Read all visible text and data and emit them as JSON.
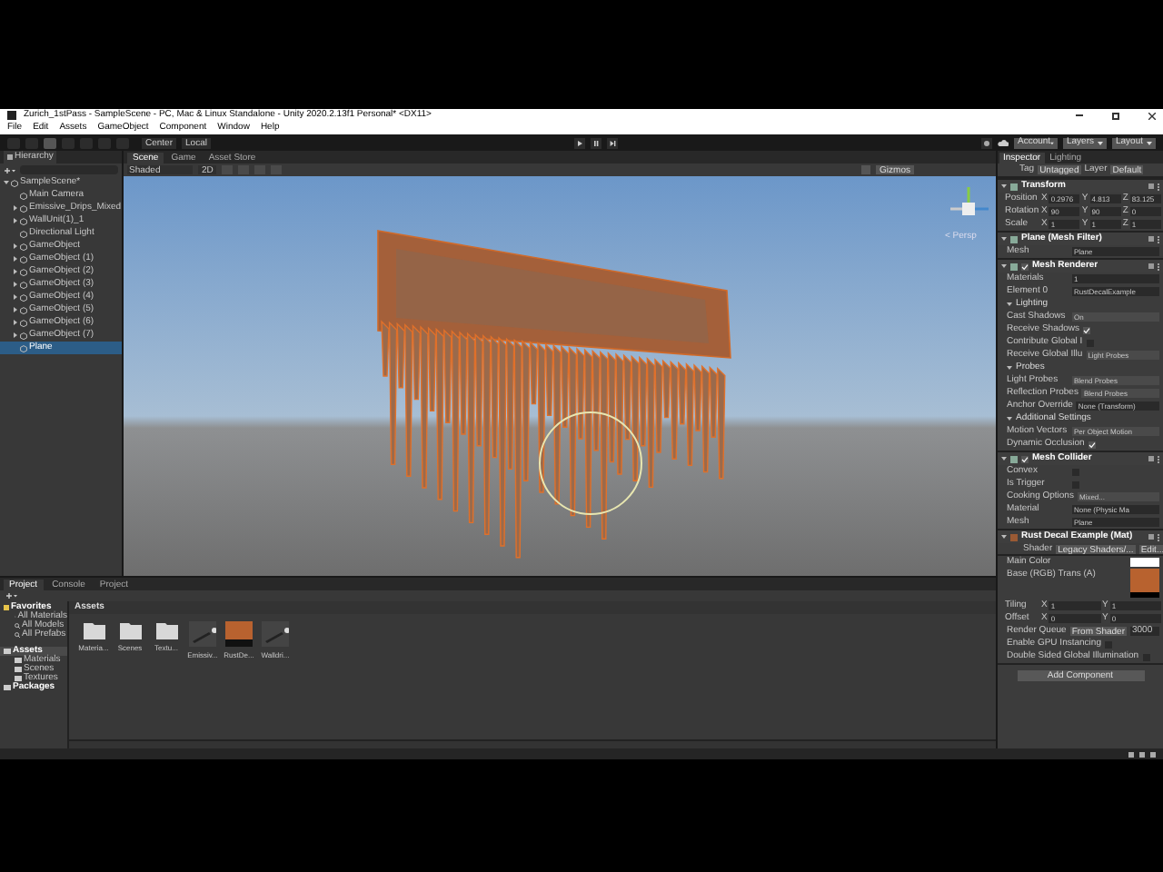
{
  "window": {
    "title": "Zurich_1stPass - SampleScene - PC, Mac & Linux Standalone - Unity 2020.2.13f1 Personal* <DX11>"
  },
  "menu": [
    "File",
    "Edit",
    "Assets",
    "GameObject",
    "Component",
    "Window",
    "Help"
  ],
  "toolbar": {
    "pivot": "Center",
    "space": "Local",
    "account": "Account",
    "layers": "Layers",
    "layout": "Layout"
  },
  "hierarchy": {
    "tab": "Hierarchy",
    "items": [
      {
        "label": "SampleScene*",
        "selected": false,
        "collapsed": false,
        "children": [
          {
            "label": "Main Camera",
            "selected": false,
            "collapsed": false
          },
          {
            "label": "Emissive_Drips_Mixed",
            "selected": false,
            "collapsed": true
          },
          {
            "label": "WallUnit(1)_1",
            "selected": false,
            "collapsed": true
          },
          {
            "label": "Directional Light",
            "selected": false,
            "collapsed": false
          },
          {
            "label": "GameObject",
            "selected": false,
            "collapsed": true
          },
          {
            "label": "GameObject (1)",
            "selected": false,
            "collapsed": true
          },
          {
            "label": "GameObject (2)",
            "selected": false,
            "collapsed": true
          },
          {
            "label": "GameObject (3)",
            "selected": false,
            "collapsed": true
          },
          {
            "label": "GameObject (4)",
            "selected": false,
            "collapsed": true
          },
          {
            "label": "GameObject (5)",
            "selected": false,
            "collapsed": true
          },
          {
            "label": "GameObject (6)",
            "selected": false,
            "collapsed": true
          },
          {
            "label": "GameObject (7)",
            "selected": false,
            "collapsed": true
          },
          {
            "label": "Plane",
            "selected": true,
            "collapsed": false
          }
        ]
      }
    ]
  },
  "scene": {
    "tabs": [
      {
        "label": "Scene",
        "selected": true
      },
      {
        "label": "Game",
        "selected": false
      },
      {
        "label": "Asset Store",
        "selected": false
      }
    ],
    "shading": "Shaded",
    "mode_2d": "2D",
    "gizmos": "Gizmos",
    "projection": "< Persp"
  },
  "project": {
    "tabs": [
      {
        "label": "Project",
        "selected": true
      },
      {
        "label": "Console",
        "selected": false
      },
      {
        "label": "Project",
        "selected": false
      }
    ],
    "favorites": {
      "label": "Favorites",
      "items": [
        "All Materials",
        "All Models",
        "All Prefabs"
      ]
    },
    "folders": [
      {
        "label": "Assets",
        "selected": true,
        "children": [
          {
            "label": "Materials"
          },
          {
            "label": "Scenes"
          },
          {
            "label": "Textures"
          }
        ]
      },
      {
        "label": "Packages",
        "selected": false
      }
    ],
    "breadcrumb": "Assets",
    "assets": [
      {
        "kind": "folder",
        "label": "Materia..."
      },
      {
        "kind": "folder",
        "label": "Scenes"
      },
      {
        "kind": "folder",
        "label": "Textu..."
      },
      {
        "kind": "prefab",
        "label": "Emissiv..."
      },
      {
        "kind": "material",
        "label": "RustDe..."
      },
      {
        "kind": "prefab",
        "label": "Walldri..."
      }
    ]
  },
  "inspector": {
    "tabs": [
      {
        "label": "Inspector",
        "selected": true
      },
      {
        "label": "Lighting",
        "selected": false
      }
    ],
    "tag_label": "Tag",
    "tag": "Untagged",
    "layer_label": "Layer",
    "layer": "Default",
    "components": [
      {
        "title": "Transform",
        "kind": "plain",
        "rows": [
          {
            "kind": "vector",
            "label": "Position",
            "values": [
              {
                "axis": "X",
                "value": "0.2976"
              },
              {
                "axis": "Y",
                "value": "4.813"
              },
              {
                "axis": "Z",
                "value": "83.125"
              }
            ]
          },
          {
            "kind": "vector",
            "label": "Rotation",
            "values": [
              {
                "axis": "X",
                "value": "90"
              },
              {
                "axis": "Y",
                "value": "90"
              },
              {
                "axis": "Z",
                "value": "0"
              }
            ]
          },
          {
            "kind": "vector",
            "label": "Scale",
            "values": [
              {
                "axis": "X",
                "value": "1"
              },
              {
                "axis": "Y",
                "value": "1"
              },
              {
                "axis": "Z",
                "value": "1"
              }
            ]
          }
        ]
      },
      {
        "title": "Plane (Mesh Filter)",
        "kind": "plain",
        "rows": [
          {
            "kind": "field",
            "label": "Mesh",
            "value": "Plane"
          }
        ]
      },
      {
        "title": "Mesh Renderer",
        "kind": "toggle",
        "enabled": true,
        "rows": [
          {
            "kind": "field",
            "label": "Materials",
            "value": "1"
          },
          {
            "kind": "field",
            "label": "Element 0",
            "value": "RustDecalExample"
          },
          {
            "kind": "section",
            "label": "Lighting"
          },
          {
            "kind": "dropdown",
            "label": "Cast Shadows",
            "value": "On"
          },
          {
            "kind": "check",
            "label": "Receive Shadows",
            "checked": true
          },
          {
            "kind": "check",
            "label": "Contribute Global I",
            "checked": false
          },
          {
            "kind": "dropdown",
            "label": "Receive Global Illu",
            "value": "Light Probes"
          },
          {
            "kind": "section",
            "label": "Probes"
          },
          {
            "kind": "dropdown",
            "label": "Light Probes",
            "value": "Blend Probes"
          },
          {
            "kind": "dropdown",
            "label": "Reflection Probes",
            "value": "Blend Probes"
          },
          {
            "kind": "field",
            "label": "Anchor Override",
            "value": "None (Transform)"
          },
          {
            "kind": "section",
            "label": "Additional Settings"
          },
          {
            "kind": "dropdown",
            "label": "Motion Vectors",
            "value": "Per Object Motion"
          },
          {
            "kind": "check",
            "label": "Dynamic Occlusion",
            "checked": true
          }
        ]
      },
      {
        "title": "Mesh Collider",
        "kind": "toggle",
        "enabled": true,
        "rows": [
          {
            "kind": "check",
            "label": "Convex",
            "checked": false
          },
          {
            "kind": "check",
            "label": "Is Trigger",
            "checked": false
          },
          {
            "kind": "dropdown",
            "label": "Cooking Options",
            "value": "Mixed..."
          },
          {
            "kind": "field",
            "label": "Material",
            "value": "None (Physic Ma"
          },
          {
            "kind": "field",
            "label": "Mesh",
            "value": "Plane"
          }
        ]
      },
      {
        "title": "Rust Decal Example (Mat)",
        "kind": "material",
        "shader_label": "Shader",
        "shader": "Legacy Shaders/...",
        "edit": "Edit...",
        "rows": [
          {
            "kind": "color",
            "label": "Main Color",
            "color": "#ffffff"
          },
          {
            "kind": "texture",
            "label": "Base (RGB) Trans (A)"
          },
          {
            "kind": "vector",
            "label": "Tiling",
            "values": [
              {
                "axis": "X",
                "value": "1"
              },
              {
                "axis": "Y",
                "value": "1"
              }
            ]
          },
          {
            "kind": "vector",
            "label": "Offset",
            "values": [
              {
                "axis": "X",
                "value": "0"
              },
              {
                "axis": "Y",
                "value": "0"
              }
            ]
          },
          {
            "kind": "queue",
            "label": "Render Queue",
            "value": "From Shader",
            "number": "3000"
          },
          {
            "kind": "check",
            "label": "Enable GPU Instancing",
            "checked": false
          },
          {
            "kind": "check",
            "label": "Double Sided Global Illumination",
            "checked": false
          }
        ]
      }
    ],
    "add_component": "Add Component"
  }
}
